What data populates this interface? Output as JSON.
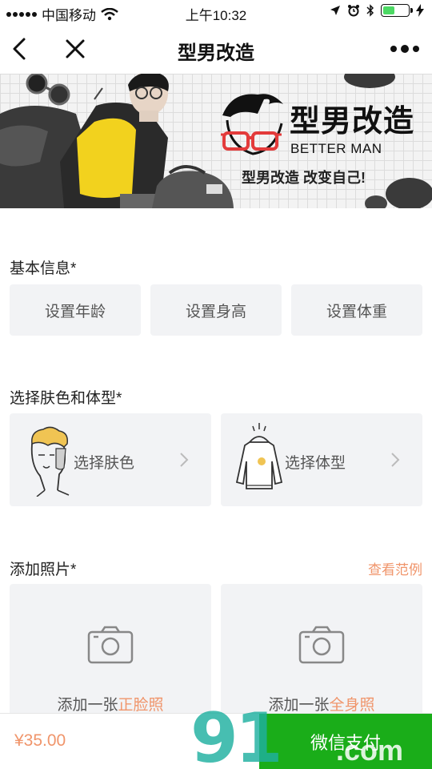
{
  "status_bar": {
    "carrier": "中国移动",
    "time": "上午10:32",
    "battery_level": 0.48,
    "icons": [
      "signal-icon",
      "wifi-icon",
      "location-icon",
      "alarm-icon",
      "bluetooth-icon",
      "battery-icon",
      "charging-icon"
    ]
  },
  "nav": {
    "title": "型男改造",
    "back_icon": "chevron-left-icon",
    "close_icon": "close-icon",
    "more_icon": "more-dots-icon"
  },
  "banner": {
    "brand_cn": "型男改造",
    "brand_en": "BETTER MAN",
    "slogan": "型男改造 改变自己!"
  },
  "basic_info": {
    "title": "基本信息*",
    "buttons": [
      "设置年龄",
      "设置身高",
      "设置体重"
    ]
  },
  "skin_body": {
    "title": "选择肤色和体型*",
    "options": [
      {
        "label": "选择肤色",
        "icon": "face-icon"
      },
      {
        "label": "选择体型",
        "icon": "sweater-icon"
      }
    ]
  },
  "photos": {
    "title": "添加照片*",
    "link": "查看范例",
    "items": [
      {
        "prefix": "添加一张",
        "highlight": "正脸照",
        "icon": "camera-icon"
      },
      {
        "prefix": "添加一张",
        "highlight": "全身照",
        "icon": "camera-icon"
      }
    ]
  },
  "bottom": {
    "price": "¥35.00",
    "pay_button": "微信支付"
  },
  "watermark": {
    "text_num": "91",
    "text_com": ".com"
  },
  "colors": {
    "accent": "#f0956b",
    "pay_green": "#1aad19",
    "card_bg": "#f2f3f5",
    "battery_green": "#4cd964"
  }
}
